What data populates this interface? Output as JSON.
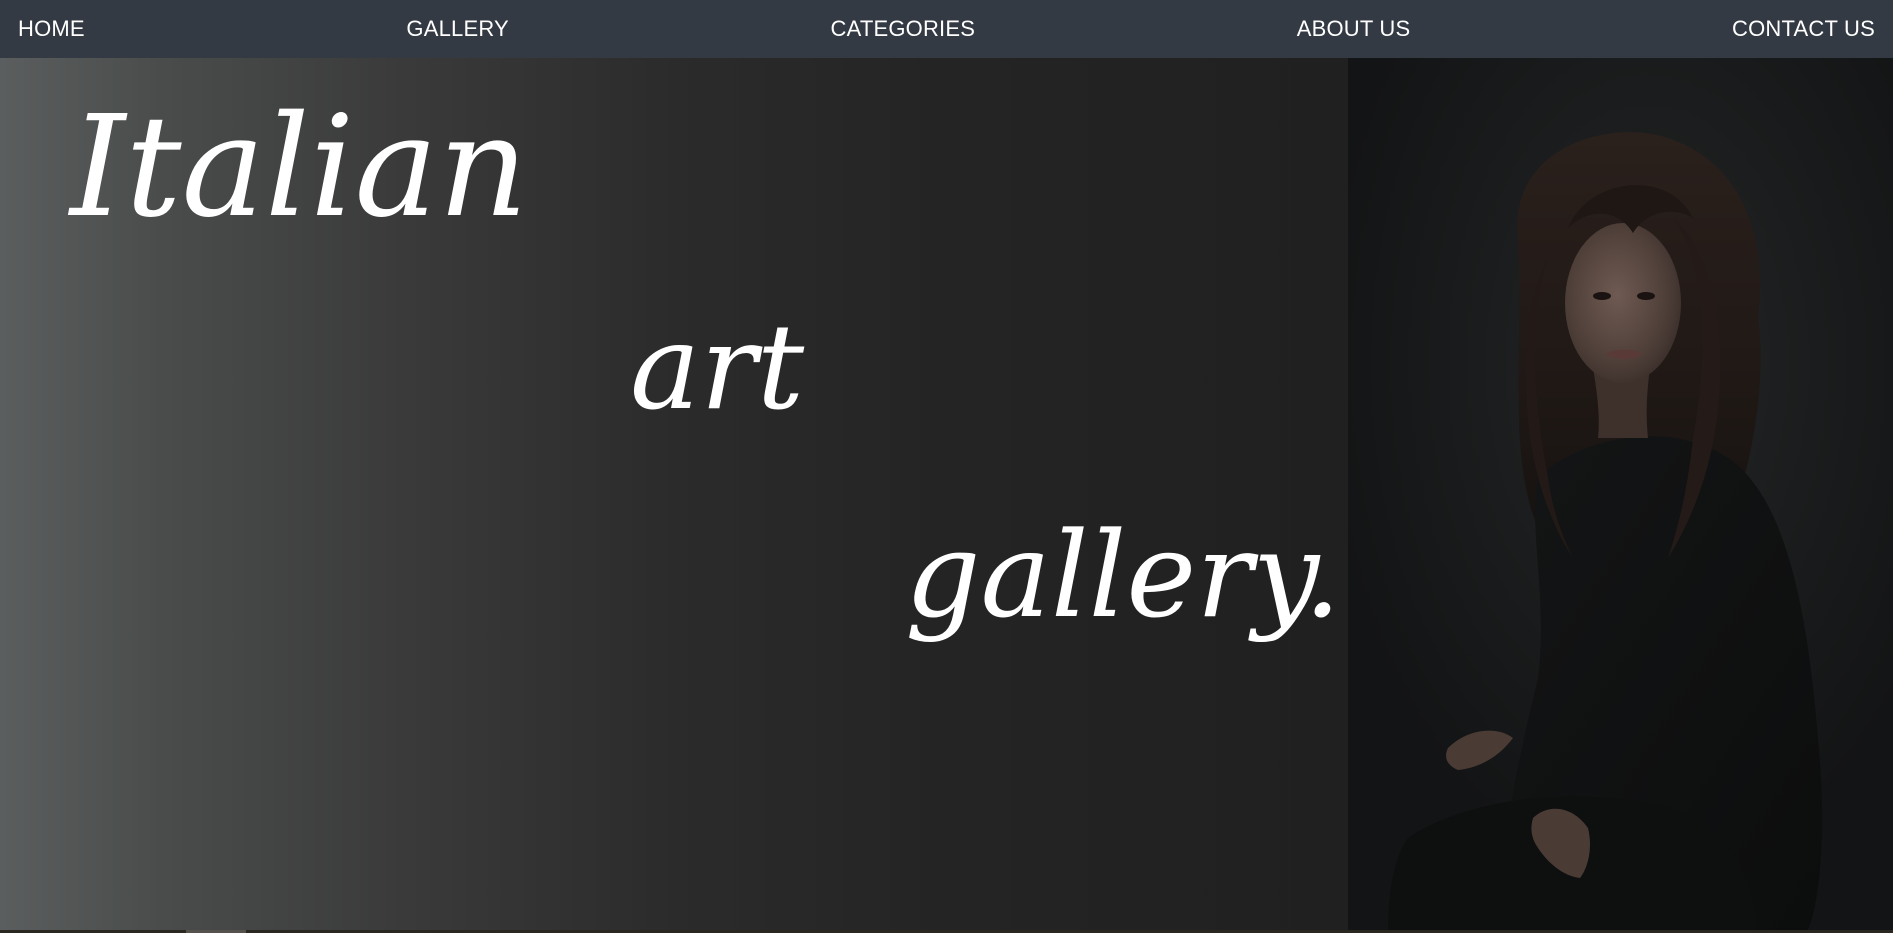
{
  "nav": {
    "items": [
      {
        "label": "HOME"
      },
      {
        "label": "GALLERY"
      },
      {
        "label": "CATEGORIES"
      },
      {
        "label": "ABOUT US"
      },
      {
        "label": "CONTACT US"
      }
    ]
  },
  "hero": {
    "words": [
      "Italian",
      "art",
      "gallery..."
    ],
    "photo_icon": "portrait-photo"
  },
  "colors": {
    "nav_background": "#343a43",
    "text": "#ffffff",
    "hero_gradient_start": "#5b5e5e",
    "hero_gradient_end": "#202020"
  }
}
